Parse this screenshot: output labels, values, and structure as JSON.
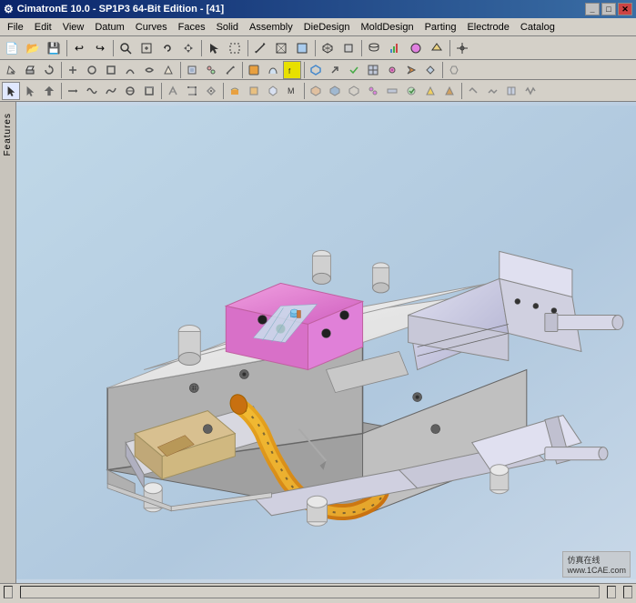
{
  "title_bar": {
    "title": "CimatronE 10.0 - SP1P3 64-Bit Edition - [41]",
    "app_icon": "cimatron-icon",
    "buttons": [
      "minimize",
      "maximize",
      "close"
    ]
  },
  "menu_bar": {
    "items": [
      "File",
      "Edit",
      "View",
      "Datum",
      "Curves",
      "Faces",
      "Solid",
      "Assembly",
      "DieDesign",
      "MoldDesign",
      "Parting",
      "Electrode",
      "Catalog"
    ]
  },
  "toolbar1": {
    "groups": [
      "file-ops",
      "edit-ops",
      "view-ops",
      "selection-ops"
    ]
  },
  "toolbar2": {
    "groups": [
      "modeling-ops"
    ]
  },
  "toolbar3": {
    "groups": [
      "extended-ops"
    ]
  },
  "features_panel": {
    "label": "Features"
  },
  "viewport": {
    "background_top": "#c8d8e8",
    "background_bottom": "#b8cce0",
    "model_description": "3D mold assembly with die components"
  },
  "status_bar": {
    "segments": [
      "",
      "",
      "",
      ""
    ]
  },
  "watermark": {
    "line1": "仿真在线",
    "line2": "www.1CAE.com"
  }
}
